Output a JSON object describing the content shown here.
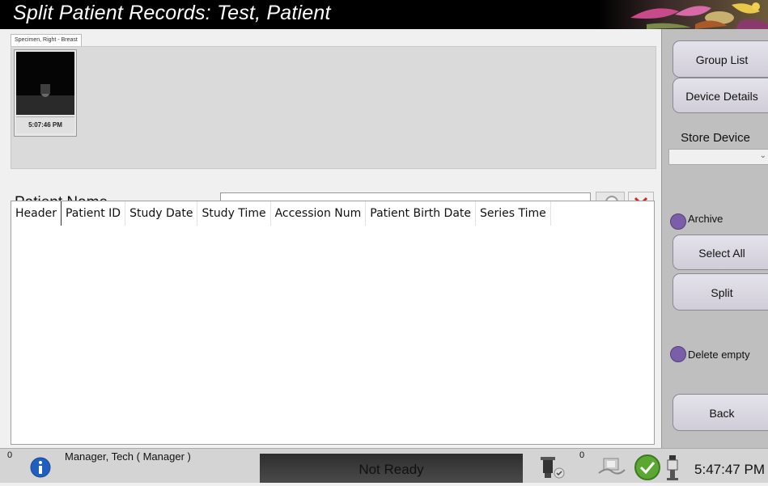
{
  "window": {
    "title": "Split Patient Records: Test, Patient"
  },
  "preview": {
    "tab_label": "Specimen, Right - Breast",
    "thumbnail_time": "5:07:46 PM"
  },
  "search": {
    "field_selected": "Patient Name",
    "input_value": "",
    "search_icon": "magnifier-icon",
    "clear_icon": "red-x-icon"
  },
  "table": {
    "columns": [
      "Header",
      "Patient ID",
      "Study Date",
      "Study Time",
      "Accession Num",
      "Patient Birth Date",
      "Series Time"
    ],
    "rows": []
  },
  "sidebar": {
    "group_list": "Group List",
    "device_details": "Device Details",
    "store_device_label": "Store Device",
    "store_device_value": "",
    "archive": "Archive",
    "select_all": "Select All",
    "split": "Split",
    "delete_empty": "Delete empty",
    "back": "Back",
    "radio_color": "#7a5fa8"
  },
  "status": {
    "left_count": "0",
    "user": "Manager, Tech ( Manager )",
    "state": "Not Ready",
    "right_count": "0",
    "clock": "5:47:47 PM"
  }
}
